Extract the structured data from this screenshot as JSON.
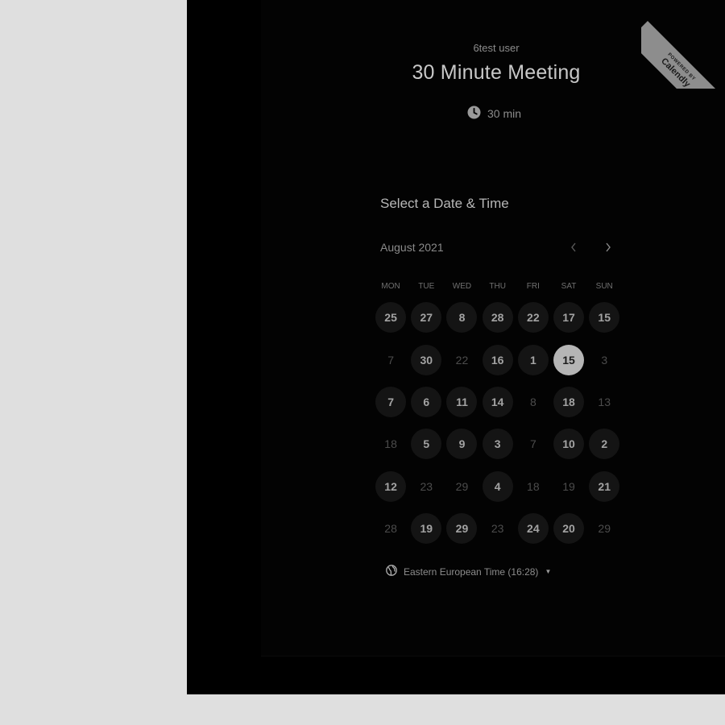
{
  "badge": {
    "line1": "POWERED BY",
    "line2": "Calendly"
  },
  "header": {
    "user_name": "6test user",
    "title": "30 Minute Meeting",
    "duration": "30 min",
    "duration_icon": "clock-icon"
  },
  "calendar": {
    "section_title": "Select a Date & Time",
    "month": "August 2021",
    "prev_icon": "chevron-left-icon",
    "next_icon": "chevron-right-icon",
    "weekdays": [
      "MON",
      "TUE",
      "WED",
      "THU",
      "FRI",
      "SAT",
      "SUN"
    ],
    "days": [
      {
        "label": "25",
        "state": "available"
      },
      {
        "label": "27",
        "state": "available"
      },
      {
        "label": "8",
        "state": "available"
      },
      {
        "label": "28",
        "state": "available"
      },
      {
        "label": "22",
        "state": "available"
      },
      {
        "label": "17",
        "state": "available"
      },
      {
        "label": "15",
        "state": "available"
      },
      {
        "label": "7",
        "state": "unavailable"
      },
      {
        "label": "30",
        "state": "available"
      },
      {
        "label": "22",
        "state": "unavailable"
      },
      {
        "label": "16",
        "state": "available"
      },
      {
        "label": "1",
        "state": "available"
      },
      {
        "label": "15",
        "state": "selected"
      },
      {
        "label": "3",
        "state": "unavailable"
      },
      {
        "label": "7",
        "state": "available"
      },
      {
        "label": "6",
        "state": "available"
      },
      {
        "label": "11",
        "state": "available"
      },
      {
        "label": "14",
        "state": "available"
      },
      {
        "label": "8",
        "state": "unavailable"
      },
      {
        "label": "18",
        "state": "available"
      },
      {
        "label": "13",
        "state": "unavailable"
      },
      {
        "label": "18",
        "state": "unavailable"
      },
      {
        "label": "5",
        "state": "available"
      },
      {
        "label": "9",
        "state": "available"
      },
      {
        "label": "3",
        "state": "available"
      },
      {
        "label": "7",
        "state": "unavailable"
      },
      {
        "label": "10",
        "state": "available"
      },
      {
        "label": "2",
        "state": "available"
      },
      {
        "label": "12",
        "state": "available"
      },
      {
        "label": "23",
        "state": "unavailable"
      },
      {
        "label": "29",
        "state": "unavailable"
      },
      {
        "label": "4",
        "state": "available"
      },
      {
        "label": "18",
        "state": "unavailable"
      },
      {
        "label": "19",
        "state": "unavailable"
      },
      {
        "label": "21",
        "state": "available"
      },
      {
        "label": "28",
        "state": "unavailable"
      },
      {
        "label": "19",
        "state": "available"
      },
      {
        "label": "29",
        "state": "available"
      },
      {
        "label": "23",
        "state": "unavailable"
      },
      {
        "label": "24",
        "state": "available"
      },
      {
        "label": "20",
        "state": "available"
      },
      {
        "label": "29",
        "state": "unavailable"
      }
    ]
  },
  "timezone": {
    "icon": "globe-icon",
    "label": "Eastern European Time (16:28)",
    "caret_icon": "caret-down-icon"
  }
}
